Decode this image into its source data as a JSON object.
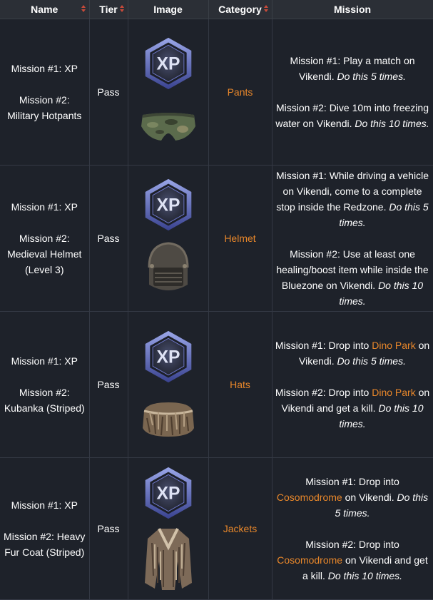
{
  "headers": {
    "name": "Name",
    "tier": "Tier",
    "image": "Image",
    "category": "Category",
    "mission": "Mission"
  },
  "xp_label": "XP",
  "rows": [
    {
      "name1": "Mission #1: XP",
      "name2": "Mission #2:",
      "name3": "Military Hotpants",
      "name4": "",
      "tier": "Pass",
      "category": "Pants",
      "item_icon": "hotpants-icon",
      "m1_prefix": "Mission #1: Play a match on Vikendi. ",
      "m1_link": "",
      "m1_suffix": "",
      "m1_italic": "Do this 5 times.",
      "m2_prefix": "Mission #2: Dive 10m into freezing water on Vikendi. ",
      "m2_link": "",
      "m2_suffix": "",
      "m2_italic": "Do this 10 times."
    },
    {
      "name1": "Mission #1: XP",
      "name2": "Mission #2:",
      "name3": "Medieval Helmet",
      "name4": "(Level 3)",
      "tier": "Pass",
      "category": "Helmet",
      "item_icon": "helmet-icon",
      "m1_prefix": "Mission #1: While driving a vehicle on Vikendi, come to a complete stop inside the Redzone. ",
      "m1_link": "",
      "m1_suffix": "",
      "m1_italic": "Do this 5 times.",
      "m2_prefix": "Mission #2: Use at least one healing/boost item while inside the Bluezone on Vikendi. ",
      "m2_link": "",
      "m2_suffix": "",
      "m2_italic": "Do this 10 times."
    },
    {
      "name1": "Mission #1: XP",
      "name2": "Mission #2:",
      "name3": "Kubanka (Striped)",
      "name4": "",
      "tier": "Pass",
      "category": "Hats",
      "item_icon": "kubanka-icon",
      "m1_prefix": "Mission #1: Drop into ",
      "m1_link": "Dino Park",
      "m1_suffix": " on Vikendi. ",
      "m1_italic": "Do this 5 times.",
      "m2_prefix": "Mission #2: Drop into ",
      "m2_link": "Dino Park",
      "m2_suffix": " on Vikendi and get a kill. ",
      "m2_italic": "Do this 10 times."
    },
    {
      "name1": "Mission #1: XP",
      "name2": "Mission #2: Heavy",
      "name3": "Fur Coat (Striped)",
      "name4": "",
      "tier": "Pass",
      "category": "Jackets",
      "item_icon": "fur-coat-icon",
      "m1_prefix": "Mission #1: Drop into ",
      "m1_link": "Cosomodrome",
      "m1_suffix": " on Vikendi. ",
      "m1_italic": "Do this 5 times.",
      "m2_prefix": "Mission #2: Drop into ",
      "m2_link": "Cosomodrome",
      "m2_suffix": " on Vikendi and get a kill. ",
      "m2_italic": "Do this 10 times."
    }
  ],
  "colors": {
    "accent": "#e8872a",
    "sort_arrow": "#c84a3a",
    "header_bg": "#2b2f36",
    "row_bg": "#1e222a"
  }
}
